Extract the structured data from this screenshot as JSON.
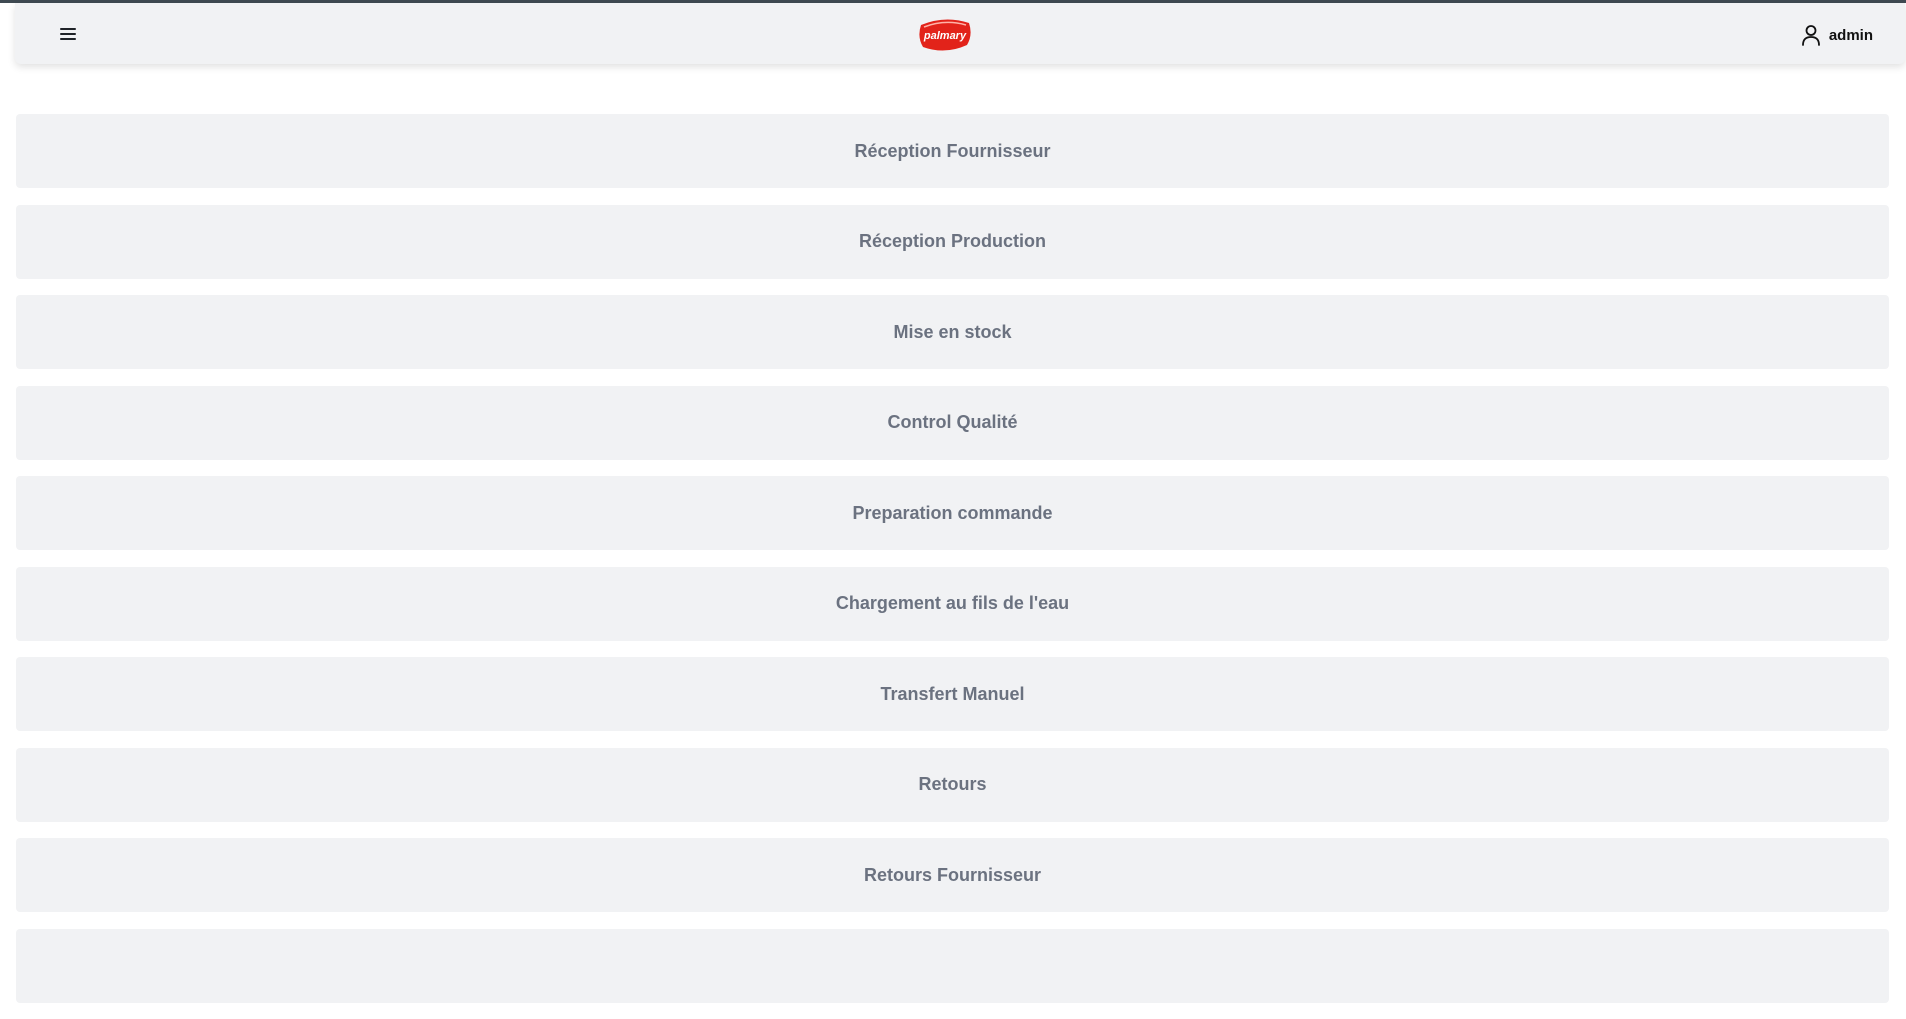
{
  "header": {
    "logo_text": "palmary",
    "menu_icon": "hamburger-menu-icon",
    "user_icon": "user-icon",
    "user_name": "admin"
  },
  "colors": {
    "header_bg": "#f1f2f4",
    "item_bg": "#f1f2f4",
    "item_text": "#6b7280",
    "logo_red": "#e2231a",
    "top_line": "#3f4a52"
  },
  "menu": {
    "items": [
      {
        "label": "Réception Fournisseur"
      },
      {
        "label": "Réception Production"
      },
      {
        "label": "Mise en stock"
      },
      {
        "label": "Control Qualité"
      },
      {
        "label": "Preparation commande"
      },
      {
        "label": "Chargement au fils de l'eau"
      },
      {
        "label": "Transfert Manuel"
      },
      {
        "label": "Retours"
      },
      {
        "label": "Retours Fournisseur"
      },
      {
        "label": ""
      }
    ]
  }
}
